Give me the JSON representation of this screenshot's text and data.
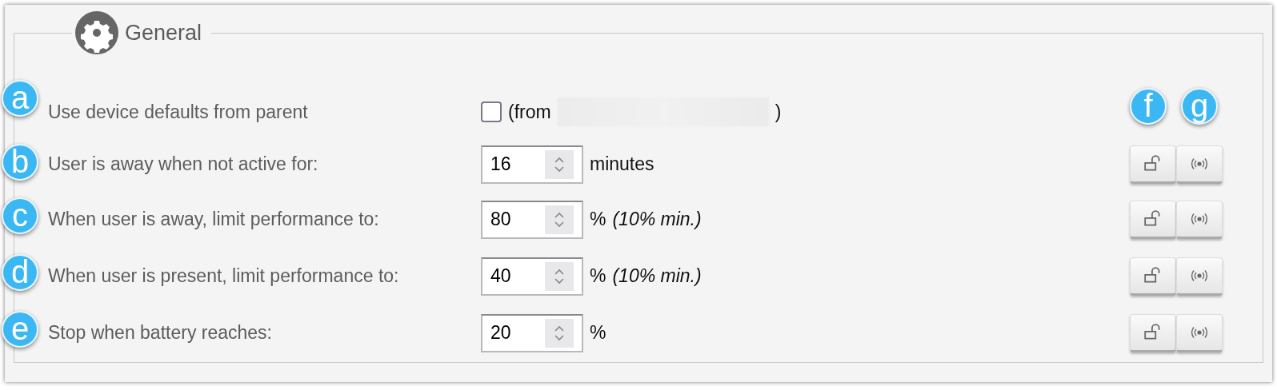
{
  "section": {
    "title": "General"
  },
  "column_badges": [
    "f",
    "g"
  ],
  "rows": [
    {
      "badge": "a",
      "label": "Use device defaults from parent",
      "kind": "checkbox",
      "checked": false,
      "prefix": "(from",
      "redacted": true,
      "suffix": ")"
    },
    {
      "badge": "b",
      "label": "User is away when not active for:",
      "kind": "spinner",
      "value": "16",
      "unit": "minutes"
    },
    {
      "badge": "c",
      "label": "When user is away, limit performance to:",
      "kind": "spinner",
      "value": "80",
      "unit": "%",
      "note": "(10% min.)"
    },
    {
      "badge": "d",
      "label": "When user is present, limit performance to:",
      "kind": "spinner",
      "value": "40",
      "unit": "%",
      "note": "(10% min.)"
    },
    {
      "badge": "e",
      "label": "Stop when battery reaches:",
      "kind": "spinner",
      "value": "20",
      "unit": "%"
    }
  ]
}
